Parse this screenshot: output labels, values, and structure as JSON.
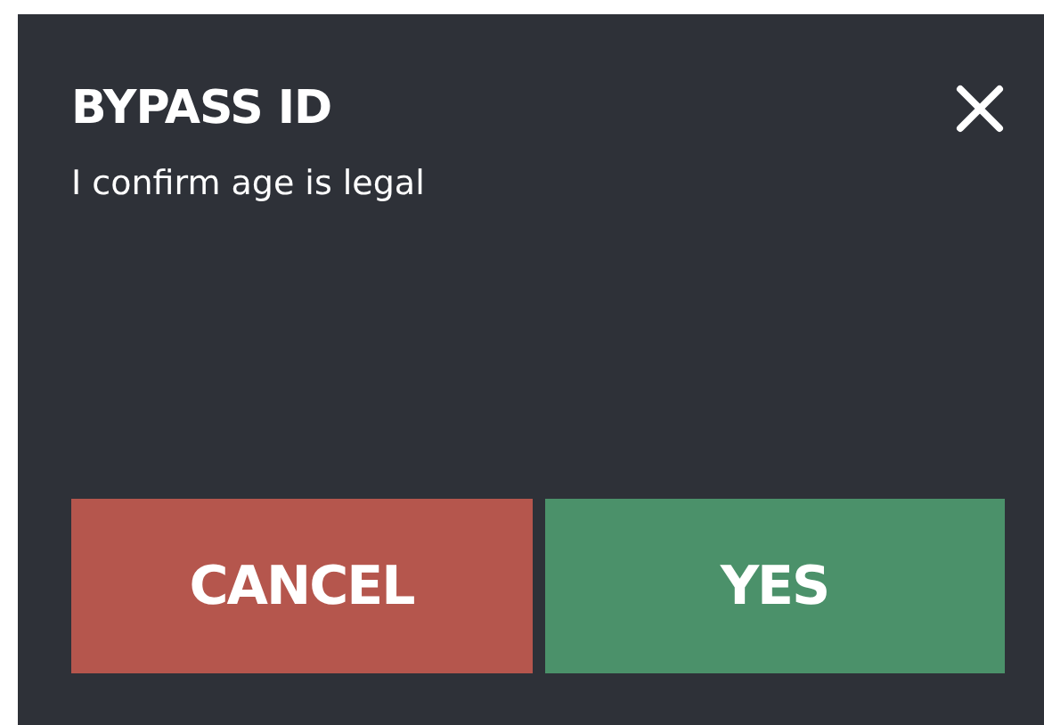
{
  "dialog": {
    "title": "BYPASS ID",
    "message": "I confirm age is legal"
  },
  "buttons": [
    {
      "label": "CANCEL",
      "kind": "cancel"
    },
    {
      "label": "YES",
      "kind": "confirm"
    }
  ]
}
